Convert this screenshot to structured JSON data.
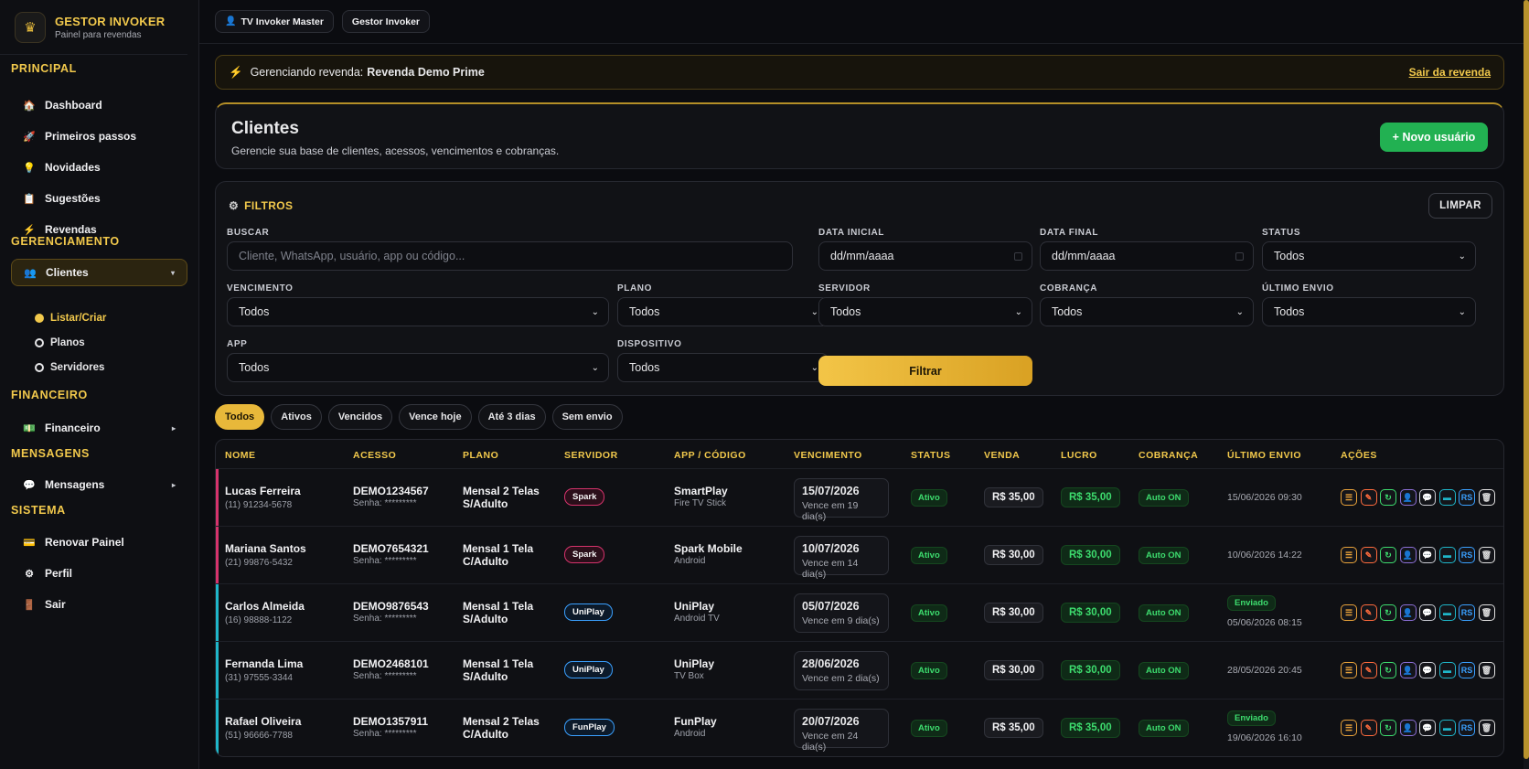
{
  "brand": {
    "title": "GESTOR INVOKER",
    "subtitle": "Painel para revendas",
    "logo_icon": "logo-icon"
  },
  "sidebar": {
    "sections": [
      "PRINCIPAL",
      "GERENCIAMENTO",
      "FINANCEIRO",
      "MENSAGENS",
      "SISTEMA"
    ],
    "principal": [
      {
        "label": "Dashboard",
        "icon": "🏠"
      },
      {
        "label": "Primeiros passos",
        "icon": "🚀"
      },
      {
        "label": "Novidades",
        "icon": "💡"
      },
      {
        "label": "Sugestões",
        "icon": "📋"
      },
      {
        "label": "Revendas",
        "icon": "⚡"
      }
    ],
    "clientes": {
      "label": "Clientes",
      "icon": "👥",
      "arrow": "▾"
    },
    "clientes_sub": [
      "Listar/Criar",
      "Planos",
      "Servidores"
    ],
    "financeiro": {
      "label": "Financeiro",
      "icon": "💵",
      "arrow": "▸"
    },
    "mensagens": {
      "label": "Mensagens",
      "icon": "💬",
      "arrow": "▸"
    },
    "sistema": [
      {
        "label": "Renovar Painel",
        "icon": "💳"
      },
      {
        "label": "Perfil",
        "icon": "⚙"
      },
      {
        "label": "Sair",
        "icon": "🚪"
      }
    ]
  },
  "topbar": {
    "tab1": "TV Invoker Master",
    "tab1_icon": "👤",
    "tab2": "Gestor Invoker"
  },
  "banner": {
    "icon": "⚡",
    "text": "Gerenciando revenda:",
    "name": "Revenda Demo Prime",
    "exit": "Sair da revenda"
  },
  "page": {
    "title": "Clientes",
    "subtitle": "Gerencie sua base de clientes, acessos, vencimentos e cobranças.",
    "new_button": "+ Novo usuário"
  },
  "filters": {
    "title": "FILTROS",
    "title_icon": "⚙",
    "clear": "LIMPAR",
    "buscar_label": "BUSCAR",
    "buscar_placeholder": "Cliente, WhatsApp, usuário, app ou código...",
    "data_inicial_label": "DATA INICIAL",
    "data_inicial_value": "dd/mm/aaaa",
    "data_final_label": "DATA FINAL",
    "data_final_value": "dd/mm/aaaa",
    "status_label": "STATUS",
    "status_value": "Todos",
    "vencimento_label": "VENCIMENTO",
    "vencimento_value": "Todos",
    "plano_label": "PLANO",
    "plano_value": "Todos",
    "servidor_label": "SERVIDOR",
    "servidor_value": "Todos",
    "cobranca_label": "COBRANÇA",
    "cobranca_value": "Todos",
    "ultimo_envio_label": "ÚLTIMO ENVIO",
    "ultimo_envio_value": "Todos",
    "app_label": "APP",
    "app_value": "Todos",
    "dispositivo_label": "DISPOSITIVO",
    "dispositivo_value": "Todos",
    "submit": "Filtrar"
  },
  "chips": [
    "Todos",
    "Ativos",
    "Vencidos",
    "Vence hoje",
    "Até 3 dias",
    "Sem envio"
  ],
  "table": {
    "headers": [
      "NOME",
      "ACESSO",
      "PLANO",
      "SERVIDOR",
      "APP / CÓDIGO",
      "VENCIMENTO",
      "STATUS",
      "VENDA",
      "LUCRO",
      "COBRANÇA",
      "ÚLTIMO ENVIO",
      "AÇÕES"
    ],
    "rows": [
      {
        "name": "Lucas Ferreira",
        "phone": "(11) 91234-5678",
        "access": "DEMO1234567",
        "senha": "Senha: *********",
        "plan1": "Mensal 2 Telas",
        "plan2": "S/Adulto",
        "server": "Spark",
        "app": "SmartPlay",
        "device": "Fire TV Stick",
        "due": "15/07/2026",
        "due_sub": "Vence em 19 dia(s)",
        "status": "Ativo",
        "venda": "R$ 35,00",
        "lucro": "R$ 35,00",
        "cobranca": "Auto ON",
        "sent_badge": "",
        "last_sent": "15/06/2026 09:30",
        "accent": "#d6336c"
      },
      {
        "name": "Mariana Santos",
        "phone": "(21) 99876-5432",
        "access": "DEMO7654321",
        "senha": "Senha: *********",
        "plan1": "Mensal 1 Tela",
        "plan2": "C/Adulto",
        "server": "Spark",
        "app": "Spark Mobile",
        "device": "Android",
        "due": "10/07/2026",
        "due_sub": "Vence em 14 dia(s)",
        "status": "Ativo",
        "venda": "R$ 30,00",
        "lucro": "R$ 30,00",
        "cobranca": "Auto ON",
        "sent_badge": "",
        "last_sent": "10/06/2026 14:22",
        "accent": "#d6336c"
      },
      {
        "name": "Carlos Almeida",
        "phone": "(16) 98888-1122",
        "access": "DEMO9876543",
        "senha": "Senha: *********",
        "plan1": "Mensal 1 Tela",
        "plan2": "S/Adulto",
        "server": "UniPlay",
        "app": "UniPlay",
        "device": "Android TV",
        "due": "05/07/2026",
        "due_sub": "Vence em 9 dia(s)",
        "status": "Ativo",
        "venda": "R$ 30,00",
        "lucro": "R$ 30,00",
        "cobranca": "Auto ON",
        "sent_badge": "Enviado",
        "last_sent": "05/06/2026 08:15",
        "accent": "#1fb6c9"
      },
      {
        "name": "Fernanda Lima",
        "phone": "(31) 97555-3344",
        "access": "DEMO2468101",
        "senha": "Senha: *********",
        "plan1": "Mensal 1 Tela",
        "plan2": "S/Adulto",
        "server": "UniPlay",
        "app": "UniPlay",
        "device": "TV Box",
        "due": "28/06/2026",
        "due_sub": "Vence em 2 dia(s)",
        "status": "Ativo",
        "venda": "R$ 30,00",
        "lucro": "R$ 30,00",
        "cobranca": "Auto ON",
        "sent_badge": "",
        "last_sent": "28/05/2026 20:45",
        "accent": "#1fb6c9"
      },
      {
        "name": "Rafael Oliveira",
        "phone": "(51) 96666-7788",
        "access": "DEMO1357911",
        "senha": "Senha: *********",
        "plan1": "Mensal 2 Telas",
        "plan2": "C/Adulto",
        "server": "FunPlay",
        "app": "FunPlay",
        "device": "Android",
        "due": "20/07/2026",
        "due_sub": "Vence em 24 dia(s)",
        "status": "Ativo",
        "venda": "R$ 35,00",
        "lucro": "R$ 35,00",
        "cobranca": "Auto ON",
        "sent_badge": "Enviado",
        "last_sent": "19/06/2026 16:10",
        "accent": "#1fb6c9"
      }
    ],
    "actions": [
      {
        "name": "menu-icon",
        "glyph": "☰",
        "color": "#e8a23a"
      },
      {
        "name": "edit-icon",
        "glyph": "✎",
        "color": "#ff6b3d"
      },
      {
        "name": "renew-icon",
        "glyph": "↻",
        "color": "#3ddc6e"
      },
      {
        "name": "user-icon",
        "glyph": "👤",
        "color": "#8b6fd6"
      },
      {
        "name": "message-icon",
        "glyph": "💬",
        "color": "#c9cbd2"
      },
      {
        "name": "card-icon",
        "glyph": "▬",
        "color": "#1fb6c9"
      },
      {
        "name": "rs-icon",
        "glyph": "RS",
        "color": "#3aa0ff"
      },
      {
        "name": "trash-icon",
        "glyph": "🗑",
        "color": "#e0e0e0"
      }
    ]
  },
  "colors": {
    "accent": "#f2c94c",
    "green": "#22b152",
    "spark": "#d6336c",
    "uniplay": "#3aa0ff"
  }
}
